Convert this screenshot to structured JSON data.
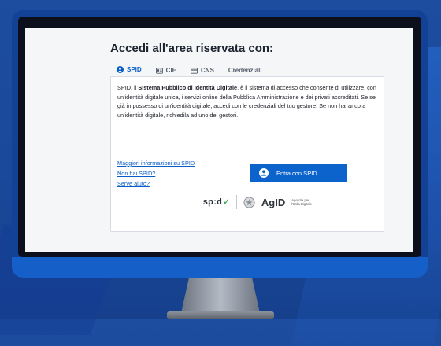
{
  "login": {
    "title": "Accedi all'area riservata con:",
    "tabs": [
      {
        "label": "SPID",
        "icon": "user-circle-icon",
        "active": true
      },
      {
        "label": "CIE",
        "icon": "id-card-icon",
        "active": false
      },
      {
        "label": "CNS",
        "icon": "card-icon",
        "active": false
      },
      {
        "label": "Credenziali",
        "icon": "",
        "active": false
      }
    ],
    "description": {
      "intro": "SPID, il ",
      "bold": "Sistema Pubblico di Identità Digitale",
      "rest": ", è il sistema di accesso che consente di utilizzare, con un'identità digitale unica, i servizi online della Pubblica Amministrazione e dei privati accreditati. Se sei già in possesso di un'identità digitale, accedi con le credenziali del tuo gestore. Se non hai ancora un'identità digitale, richiedila ad uno dei gestori."
    },
    "links": [
      "Maggiori informazioni su SPID",
      "Non hai SPID?",
      "Serve aiuto?"
    ],
    "spid_button": "Entra con SPID",
    "footer": {
      "spid_logo": "sp:d",
      "agid_logo": "AgID",
      "agid_sub": "Agenzia per l'Italia Digitale"
    }
  },
  "colors": {
    "accent": "#0b63cb",
    "background": "#1d4d9f",
    "spid_check": "#39a74a"
  }
}
